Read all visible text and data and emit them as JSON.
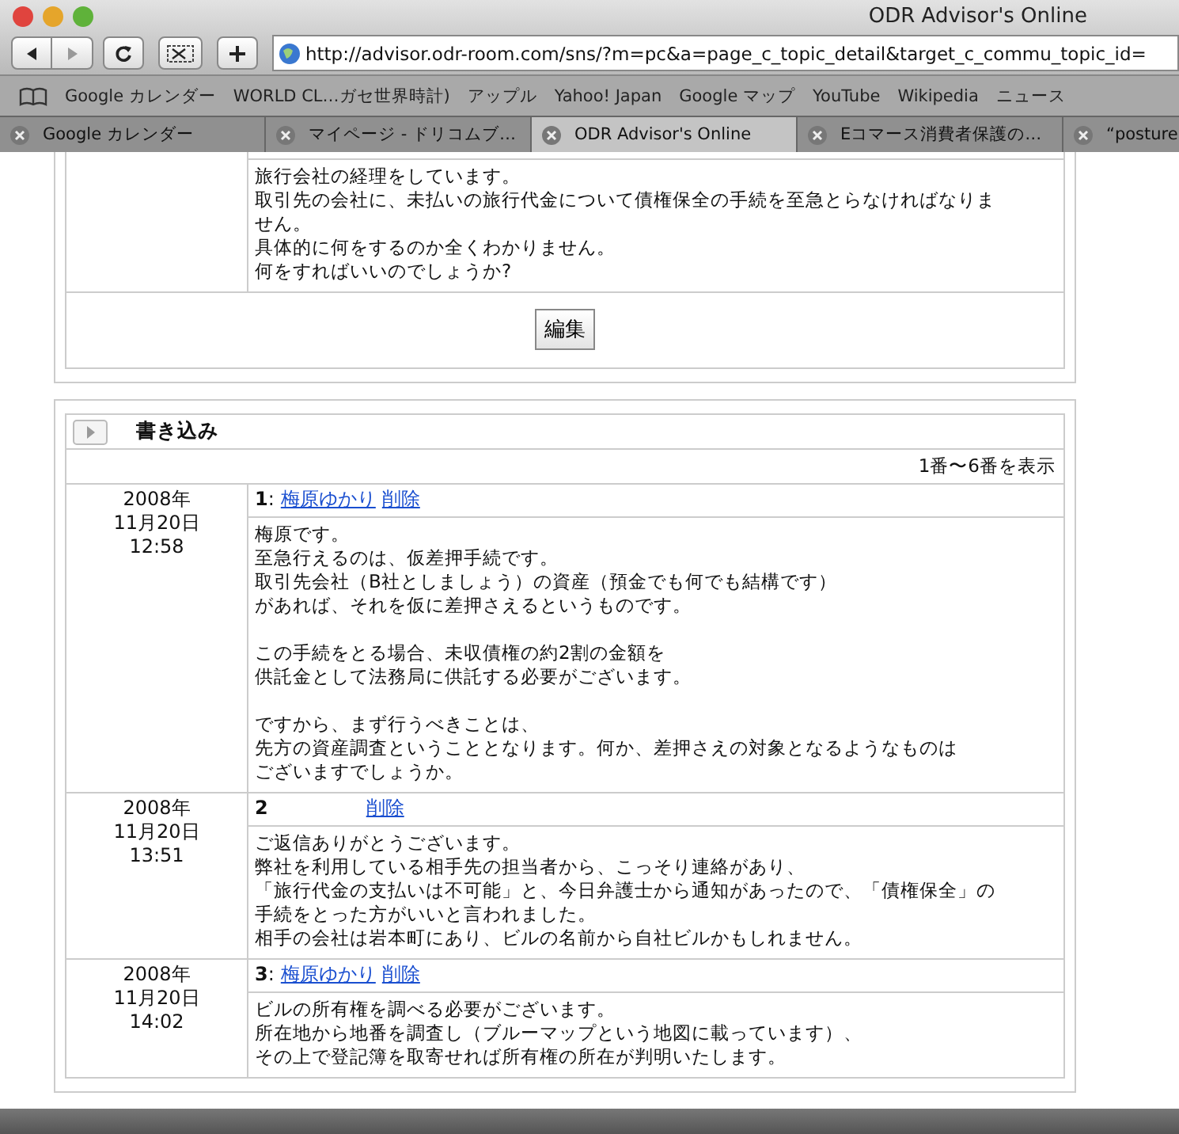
{
  "window": {
    "title": "ODR Advisor's Online"
  },
  "toolbar": {
    "url": "http://advisor.odr-room.com/sns/?m=pc&a=page_c_topic_detail&target_c_commu_topic_id="
  },
  "bookmarks": [
    "Google カレンダー",
    "WORLD CL…ガセ世界時計)",
    "アップル",
    "Yahoo! Japan",
    "Google マップ",
    "YouTube",
    "Wikipedia",
    "ニュース"
  ],
  "tabs": [
    {
      "label": "Google カレンダー",
      "selected": false
    },
    {
      "label": "マイページ - ドリコムブ…",
      "selected": false
    },
    {
      "label": "ODR Advisor's Online",
      "selected": true
    },
    {
      "label": "Eコマース消費者保護の…",
      "selected": false
    },
    {
      "label": "“posture",
      "selected": false
    }
  ],
  "topic": {
    "body": [
      "旅行会社の経理をしています。",
      "取引先の会社に、未払いの旅行代金について債権保全の手続を至急とらなければなりま",
      "せん。",
      "具体的に何をするのか全くわかりません。",
      "何をすればいいのでしょうか?"
    ],
    "edit_button": "編集"
  },
  "comments": {
    "title": "書き込み",
    "range": "1番〜6番を表示",
    "items": [
      {
        "date": "2008年",
        "day": "11月20日",
        "time": "12:58",
        "number": "1",
        "separator": ":",
        "author": "梅原ゆかり",
        "delete": "削除",
        "paragraphs": [
          [
            "梅原です。",
            "至急行えるのは、仮差押手続です。",
            "取引先会社（B社としましょう）の資産（預金でも何でも結構です）",
            "があれば、それを仮に差押さえるというものです。"
          ],
          [
            "この手続をとる場合、未収債権の約2割の金額を",
            "供託金として法務局に供託する必要がございます。"
          ],
          [
            "ですから、まず行うべきことは、",
            "先方の資産調査ということとなります。何か、差押さえの対象となるようなものは",
            "ございますでしょうか。"
          ]
        ]
      },
      {
        "date": "2008年",
        "day": "11月20日",
        "time": "13:51",
        "number": "2",
        "delete": "削除",
        "paragraphs": [
          [
            "ご返信ありがとうございます。",
            "弊社を利用している相手先の担当者から、こっそり連絡があり、",
            "「旅行代金の支払いは不可能」と、今日弁護士から通知があったので、「債権保全」の",
            "手続をとった方がいいと言われました。",
            "相手の会社は岩本町にあり、ビルの名前から自社ビルかもしれません。"
          ]
        ]
      },
      {
        "date": "2008年",
        "day": "11月20日",
        "time": "14:02",
        "number": "3",
        "separator": ":",
        "author": "梅原ゆかり",
        "delete": "削除",
        "paragraphs": [
          [
            "ビルの所有権を調べる必要がございます。",
            "所在地から地番を調査し（ブルーマップという地図に載っています）、",
            "その上で登記簿を取寄せれば所有権の所在が判明いたします。"
          ]
        ]
      }
    ]
  }
}
